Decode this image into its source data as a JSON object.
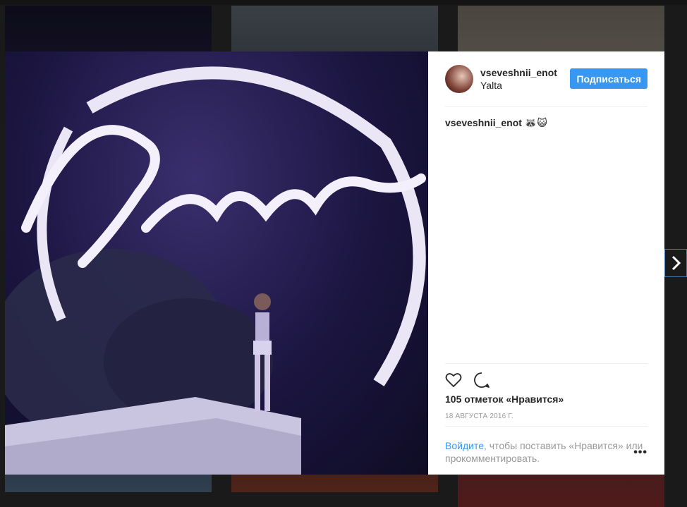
{
  "post": {
    "username": "vseveshnii_enot",
    "location": "Yalta",
    "follow_label": "Подписаться",
    "caption_user": "vseveshnii_enot",
    "caption_text": "🦝😺",
    "likes": "105 отметок «Нравится»",
    "date": "18 АВГУСТА 2016 Г.",
    "login_link": "Войдите",
    "login_text": ", чтобы поставить «Нравится» или прокомментировать.",
    "more": "•••"
  },
  "icons": {
    "like": "heart-icon",
    "comment": "comment-icon",
    "next": "chevron-right-icon"
  },
  "colors": {
    "accent": "#3897f0",
    "photo_bg": "#1b1540"
  }
}
